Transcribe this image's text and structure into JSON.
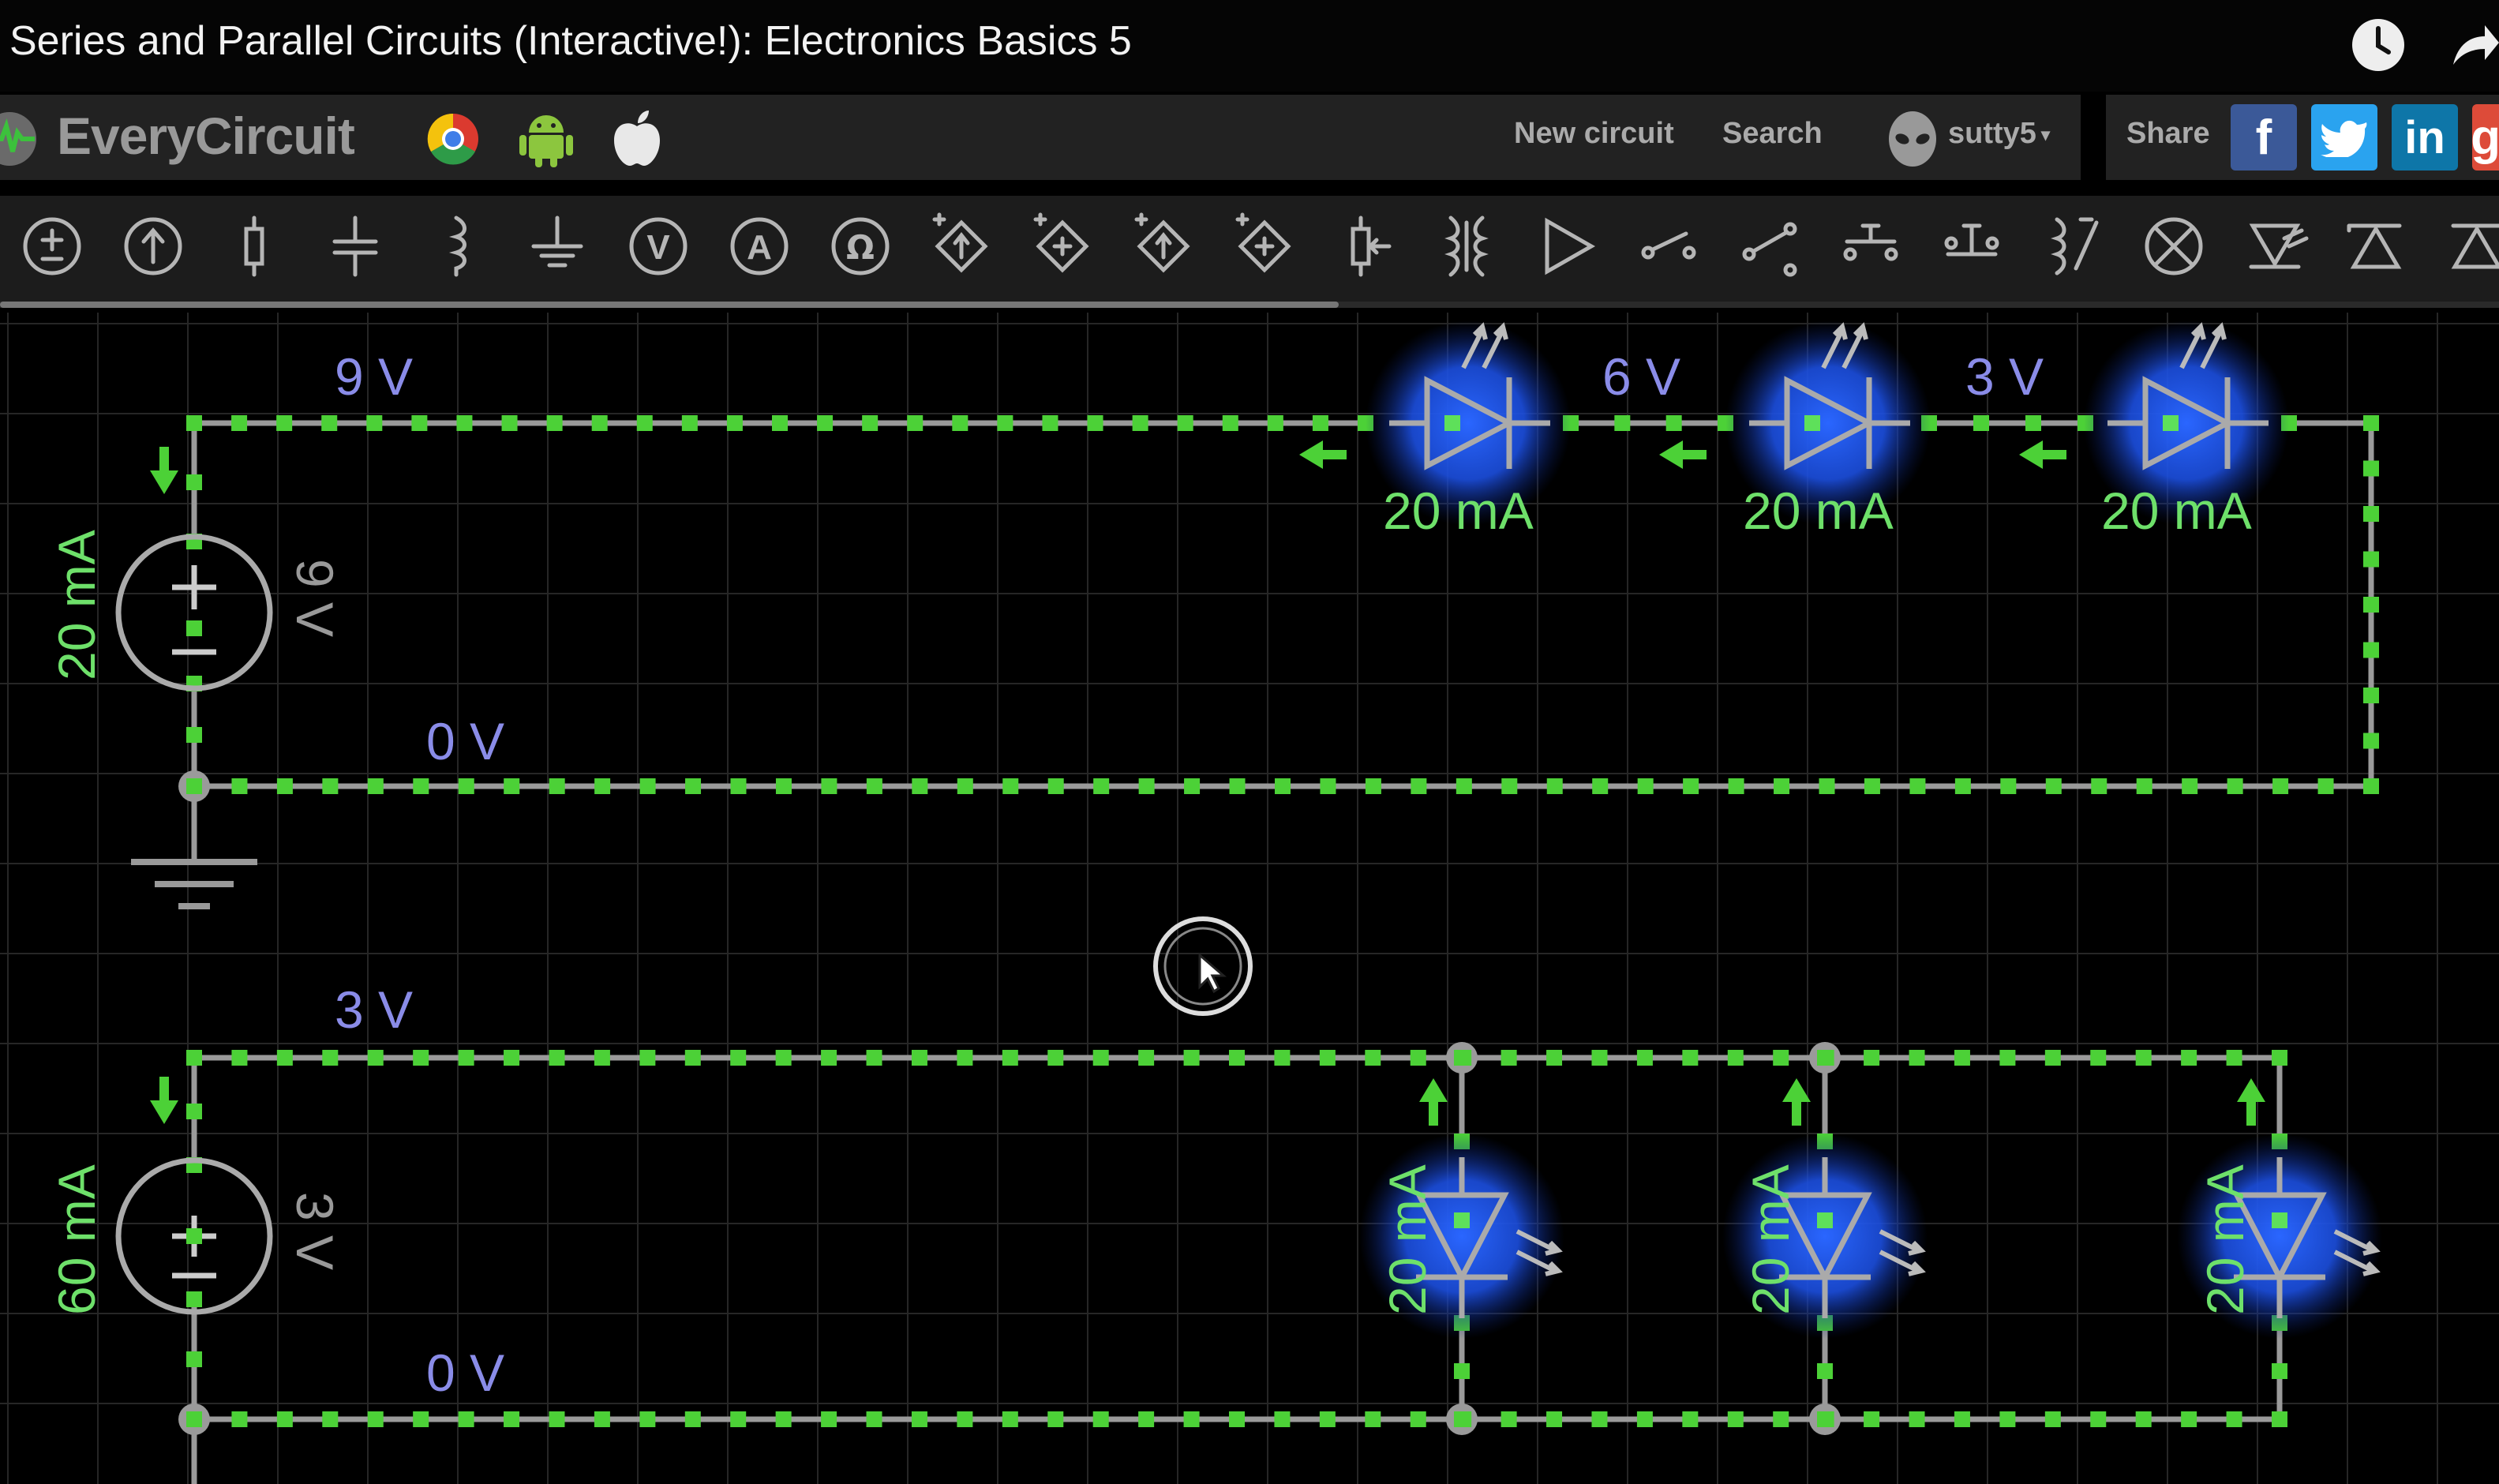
{
  "video": {
    "title": "Series and Parallel Circuits (Interactive!): Electronics Basics 5"
  },
  "header": {
    "logo_text": "EveryCircuit",
    "platform_icons": [
      "chrome-icon",
      "android-icon",
      "apple-icon"
    ],
    "nav": {
      "new_circuit": "New circuit",
      "search": "Search",
      "user": "sutty5"
    }
  },
  "share": {
    "label": "Share",
    "networks": [
      "f",
      "t",
      "in",
      "g"
    ]
  },
  "toolbar": {
    "components": [
      "dc-current-source",
      "dc-voltage-source",
      "capacitor",
      "capacitor-nonpolar",
      "inductor",
      "ground",
      "voltmeter",
      "ammeter",
      "ohmmeter",
      "diamond-source-1",
      "diamond-source-2",
      "diamond-source-3",
      "diamond-source-4",
      "potentiometer",
      "transformer",
      "buffer",
      "switch-spst",
      "switch-spdt",
      "push-button-no",
      "push-button-nc",
      "relay",
      "lamp",
      "diode",
      "zener-diode",
      "led"
    ]
  },
  "colors": {
    "wire": "#9a9a9a",
    "current_dot": "#4cd137",
    "voltage_label": "#8a8ce8",
    "current_label": "#6ee06a",
    "led_glow": "#1f5bff",
    "grid": "#262626"
  },
  "circuit": {
    "series": {
      "source_voltage": "9 V",
      "source_current": "20 mA",
      "node_voltages": [
        "9 V",
        "6 V",
        "3 V"
      ],
      "led_currents": [
        "20 mA",
        "20 mA",
        "20 mA"
      ],
      "ground_voltage": "0 V"
    },
    "parallel": {
      "source_voltage": "3 V",
      "source_current": "60 mA",
      "top_voltage": "3 V",
      "led_currents": [
        "20 mA",
        "20 mA",
        "20 mA"
      ],
      "ground_voltage": "0 V"
    }
  }
}
